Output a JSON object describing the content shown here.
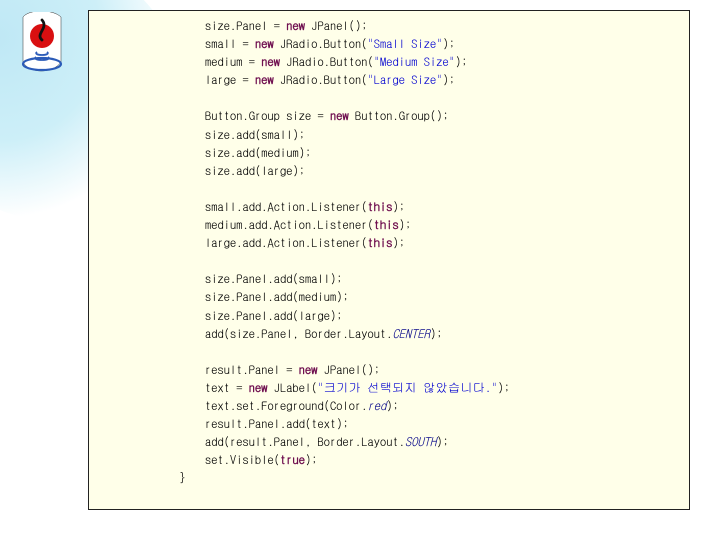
{
  "code": {
    "l1_a": "size.Panel = ",
    "l1_k": "new",
    "l1_b": " JPanel();",
    "l2_a": "small = ",
    "l2_k": "new",
    "l2_b": " JRadio.Button(",
    "l2_s": "\"Small Size\"",
    "l2_c": ");",
    "l3_a": "medium = ",
    "l3_k": "new",
    "l3_b": " JRadio.Button(",
    "l3_s": "\"Medium Size\"",
    "l3_c": ");",
    "l4_a": "large = ",
    "l4_k": "new",
    "l4_b": " JRadio.Button(",
    "l4_s": "\"Large Size\"",
    "l4_c": ");",
    "l5_a": "Button.Group size = ",
    "l5_k": "new",
    "l5_b": " Button.Group();",
    "l6": "size.add(small);",
    "l7": "size.add(medium);",
    "l8": "size.add(large);",
    "l9_a": "small.add.Action.Listener(",
    "l9_k": "this",
    "l9_b": ");",
    "l10_a": "medium.add.Action.Listener(",
    "l10_k": "this",
    "l10_b": ");",
    "l11_a": "large.add.Action.Listener(",
    "l11_k": "this",
    "l11_b": ");",
    "l12": "size.Panel.add(small);",
    "l13": "size.Panel.add(medium);",
    "l14": "size.Panel.add(large);",
    "l15_a": "add(size.Panel, Border.Layout.",
    "l15_i": "CENTER",
    "l15_b": ");",
    "l16_a": "result.Panel = ",
    "l16_k": "new",
    "l16_b": " JPanel();",
    "l17_a": "text = ",
    "l17_k": "new",
    "l17_b": " JLabel(",
    "l17_s": "\"크기가 선택되지 않았습니다.\"",
    "l17_c": ");",
    "l18_a": "text.set.Foreground(Color.",
    "l18_i": "red",
    "l18_b": ");",
    "l19": "result.Panel.add(text);",
    "l20_a": "add(result.Panel, Border.Layout.",
    "l20_i": "SOUTH",
    "l20_b": ");",
    "l21_a": "set.Visible(",
    "l21_k": "true",
    "l21_b": ");",
    "l22": "}"
  }
}
